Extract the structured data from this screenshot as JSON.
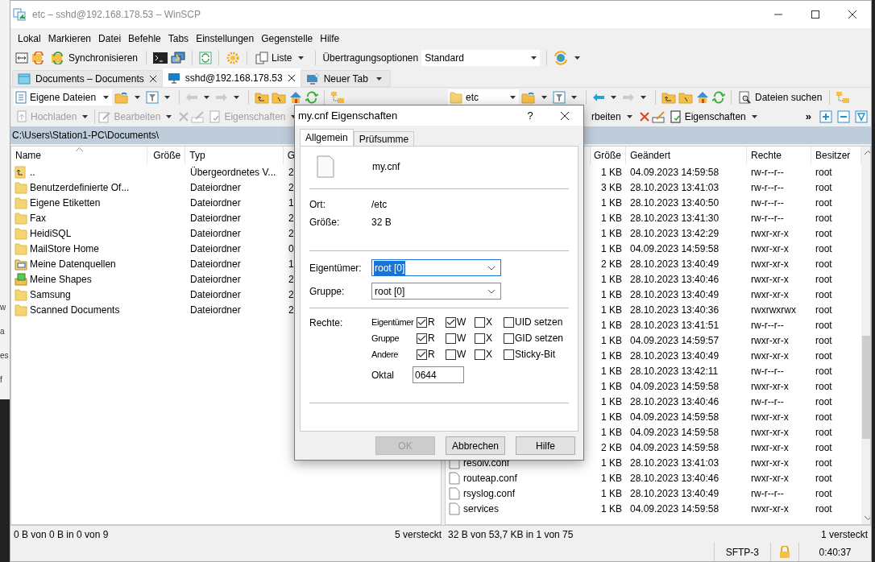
{
  "window": {
    "title": "etc – sshd@192.168.178.53 – WinSCP"
  },
  "desktop_fragments": [
    "w",
    "a",
    "es",
    "f"
  ],
  "menu": [
    "Lokal",
    "Markieren",
    "Datei",
    "Befehle",
    "Tabs",
    "Einstellungen",
    "Gegenstelle",
    "Hilfe"
  ],
  "toolbar": {
    "sync_label": "Synchronisieren",
    "view_label": "Liste",
    "transfer_label": "Übertragungsoptionen",
    "transfer_value": "Standard"
  },
  "tabs": [
    {
      "label": "Documents – Documents",
      "selected": false,
      "closable": true
    },
    {
      "label": "sshd@192.168.178.53",
      "selected": true,
      "closable": true
    },
    {
      "label": "Neuer Tab",
      "selected": false,
      "closable": false
    }
  ],
  "left_panel": {
    "location": "Eigene Dateien",
    "actions": [
      {
        "label": "Hochladen",
        "disabled": true
      },
      {
        "label": "Bearbeiten",
        "disabled": true
      },
      {
        "label": "Eigenschaften",
        "disabled": true
      }
    ],
    "path": "C:\\Users\\Station1-PC\\Documents\\",
    "columns": [
      "Name",
      "Größe",
      "Typ",
      "G"
    ],
    "rows": [
      {
        "name": "..",
        "kind": "parent",
        "type": "Übergeordnetes V...",
        "column_4": "2"
      },
      {
        "name": "Benutzerdefinierte Of...",
        "kind": "folder",
        "type": "Dateiordner",
        "column_4": "2"
      },
      {
        "name": "Eigene Etiketten",
        "kind": "folder",
        "type": "Dateiordner",
        "column_4": "1"
      },
      {
        "name": "Fax",
        "kind": "folder",
        "type": "Dateiordner",
        "column_4": "2"
      },
      {
        "name": "HeidiSQL",
        "kind": "folder",
        "type": "Dateiordner",
        "column_4": "2"
      },
      {
        "name": "MailStore Home",
        "kind": "folder",
        "type": "Dateiordner",
        "column_4": "0"
      },
      {
        "name": "Meine Datenquellen",
        "kind": "data_folder",
        "type": "Dateiordner",
        "column_4": "1"
      },
      {
        "name": "Meine Shapes",
        "kind": "shapes_folder",
        "type": "Dateiordner",
        "column_4": "2"
      },
      {
        "name": "Samsung",
        "kind": "folder",
        "type": "Dateiordner",
        "column_4": "2"
      },
      {
        "name": "Scanned Documents",
        "kind": "folder",
        "type": "Dateiordner",
        "column_4": "2"
      }
    ],
    "status": "0 B von 0 B in 0 von 9",
    "hidden_count": "5 versteckt"
  },
  "right_panel": {
    "location": "etc",
    "find_label": "Dateien suchen",
    "actions": [
      {
        "label": "rbeiten",
        "disabled": false
      },
      {
        "label": "Eigenschaften",
        "disabled": false
      }
    ],
    "overflow": "»",
    "columns": [
      "Größe",
      "Geändert",
      "Rechte",
      "Besitzer"
    ],
    "rows": [
      {
        "size": "1 KB",
        "changed": "04.09.2023 14:59:58",
        "rights": "rw-r--r--",
        "owner": "root"
      },
      {
        "size": "3 KB",
        "changed": "28.10.2023 13:41:03",
        "rights": "rw-r--r--",
        "owner": "root"
      },
      {
        "size": "1 KB",
        "changed": "28.10.2023 13:40:50",
        "rights": "rw-r--r--",
        "owner": "root"
      },
      {
        "size": "1 KB",
        "changed": "28.10.2023 13:41:30",
        "rights": "rw-r--r--",
        "owner": "root"
      },
      {
        "size": "1 KB",
        "changed": "28.10.2023 13:42:29",
        "rights": "rwxr-xr-x",
        "owner": "root"
      },
      {
        "size": "1 KB",
        "changed": "04.09.2023 14:59:58",
        "rights": "rwxr-xr-x",
        "owner": "root"
      },
      {
        "size": "2 KB",
        "changed": "28.10.2023 13:40:49",
        "rights": "rwxr-xr-x",
        "owner": "root"
      },
      {
        "size": "1 KB",
        "changed": "28.10.2023 13:40:46",
        "rights": "rwxr-xr-x",
        "owner": "root"
      },
      {
        "size": "1 KB",
        "changed": "28.10.2023 13:40:49",
        "rights": "rwxr-xr-x",
        "owner": "root"
      },
      {
        "size": "1 KB",
        "changed": "28.10.2023 13:40:36",
        "rights": "rwxrwxrwx",
        "owner": "root"
      },
      {
        "size": "1 KB",
        "changed": "28.10.2023 13:41:51",
        "rights": "rw-r--r--",
        "owner": "root"
      },
      {
        "size": "1 KB",
        "changed": "04.09.2023 14:59:57",
        "rights": "rwxr-xr-x",
        "owner": "root"
      },
      {
        "size": "1 KB",
        "changed": "28.10.2023 13:40:49",
        "rights": "rwxr-xr-x",
        "owner": "root"
      },
      {
        "size": "1 KB",
        "changed": "28.10.2023 13:42:11",
        "rights": "rw-r--r--",
        "owner": "root"
      },
      {
        "size": "1 KB",
        "changed": "04.09.2023 14:59:58",
        "rights": "rwxr-xr-x",
        "owner": "root"
      },
      {
        "size": "1 KB",
        "changed": "28.10.2023 13:40:46",
        "rights": "rw-r--r--",
        "owner": "root"
      },
      {
        "size": "1 KB",
        "changed": "04.09.2023 14:59:58",
        "rights": "rwxr-xr-x",
        "owner": "root"
      },
      {
        "size": "1 KB",
        "changed": "04.09.2023 14:59:58",
        "rights": "rwxr-xr-x",
        "owner": "root"
      },
      {
        "size": "2 KB",
        "changed": "04.09.2023 14:59:58",
        "rights": "rwxr-xr-x",
        "owner": "root"
      },
      {
        "name": "resolv.conf",
        "size": "1 KB",
        "changed": "28.10.2023 13:41:03",
        "rights": "rwxr-xr-x",
        "owner": "root"
      },
      {
        "name": "routeap.conf",
        "size": "1 KB",
        "changed": "28.10.2023 13:40:46",
        "rights": "rwxr-xr-x",
        "owner": "root"
      },
      {
        "name": "rsyslog.conf",
        "size": "1 KB",
        "changed": "28.10.2023 13:40:49",
        "rights": "rw-r--r--",
        "owner": "root"
      },
      {
        "name": "services",
        "size": "1 KB",
        "changed": "04.09.2023 14:59:58",
        "rights": "rwxr-xr-x",
        "owner": "root"
      }
    ],
    "status": "32 B von 53,7 KB in 1 von 75",
    "hidden_count": "1 versteckt"
  },
  "dialog": {
    "title": "my.cnf Eigenschaften",
    "help": "?",
    "tabs": [
      {
        "label": "Allgemein",
        "selected": true
      },
      {
        "label": "Prüfsumme",
        "selected": false
      }
    ],
    "file_name": "my.cnf",
    "info": [
      {
        "label": "Ort:",
        "value": "/etc"
      },
      {
        "label": "Größe:",
        "value": "32 B"
      }
    ],
    "owner": {
      "label": "Eigentümer:",
      "value": "root [0]",
      "focused": true
    },
    "group": {
      "label": "Gruppe:",
      "value": "root [0]",
      "focused": false
    },
    "rights_label": "Rechte:",
    "rights": [
      {
        "label": "Eigentümer",
        "bits": [
          {
            "label": "R",
            "checked": true
          },
          {
            "label": "W",
            "checked": true
          },
          {
            "label": "X",
            "checked": false
          }
        ],
        "special": {
          "label": "UID setzen",
          "checked": false
        }
      },
      {
        "label": "Gruppe",
        "bits": [
          {
            "label": "R",
            "checked": true
          },
          {
            "label": "W",
            "checked": false
          },
          {
            "label": "X",
            "checked": false
          }
        ],
        "special": {
          "label": "GID setzen",
          "checked": false
        }
      },
      {
        "label": "Andere",
        "bits": [
          {
            "label": "R",
            "checked": true
          },
          {
            "label": "W",
            "checked": false
          },
          {
            "label": "X",
            "checked": false
          }
        ],
        "special": {
          "label": "Sticky-Bit",
          "checked": false
        }
      }
    ],
    "octal": {
      "label": "Oktal",
      "value": "0644"
    },
    "buttons": [
      {
        "label": "OK",
        "disabled": true
      },
      {
        "label": "Abbrechen",
        "disabled": false
      },
      {
        "label": "Hilfe",
        "disabled": false
      }
    ]
  },
  "status_bar": {
    "protocol": "SFTP-3",
    "time": "0:40:37"
  }
}
